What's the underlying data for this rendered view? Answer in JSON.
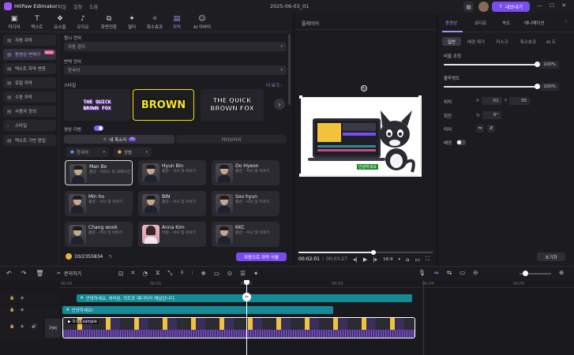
{
  "titlebar": {
    "app_title": "HitPaw Edimakor",
    "menu": [
      "파일",
      "설정",
      "도움"
    ],
    "project_name": "2025-06-03_01",
    "export_label": "내보내기",
    "window_controls": [
      "—",
      "☐",
      "✕"
    ]
  },
  "toolbar": {
    "tools": [
      {
        "label": "미디어",
        "icon": "▣"
      },
      {
        "label": "텍스트",
        "icon": "T"
      },
      {
        "label": "요소들",
        "icon": "❖"
      },
      {
        "label": "오디오",
        "icon": "♪"
      },
      {
        "label": "화면전환",
        "icon": "⧉"
      },
      {
        "label": "필터",
        "icon": "✦"
      },
      {
        "label": "특수효과",
        "icon": "✧"
      },
      {
        "label": "자막",
        "icon": "▤"
      },
      {
        "label": "AI 아바타",
        "icon": "☺"
      }
    ],
    "active_index": 7
  },
  "sidebar": {
    "items": [
      {
        "label": "자동 자막",
        "icon": "▤"
      },
      {
        "label": "동영상 번역기",
        "icon": "▤",
        "badge": "NEW"
      },
      {
        "label": "텍스트 자막 변환",
        "icon": "▤"
      },
      {
        "label": "로컬 자막",
        "icon": "▤"
      },
      {
        "label": "수동 자막",
        "icon": "▤"
      },
      {
        "label": "사용자 정의",
        "icon": "▤"
      },
      {
        "label": "스타일",
        "icon": "›"
      },
      {
        "label": "텍스트 기반 편집",
        "icon": "▤"
      }
    ],
    "active_index": 1
  },
  "translator": {
    "source_label": "원시 언어",
    "source_value": "자동 감지",
    "target_label": "번역 언어",
    "target_value": "한국어",
    "style_label": "스타일",
    "more_label": "더 보기 ›",
    "styles": [
      {
        "line1": "THE QUICK",
        "line2": "BROWN FOX"
      },
      {
        "line1": "BROWN",
        "line2": ""
      },
      {
        "line1": "THE QUICK",
        "line2": "BROWN FOX"
      }
    ],
    "dubbing_label": "영상 더빙",
    "dubbing_on": true,
    "voice_tab_mine": "내 목소리",
    "voice_tab_ai": "AI",
    "voice_tab_library": "라이브러리",
    "lang_filter": "한국어",
    "gender_filter": "성별",
    "voices": [
      {
        "name": "Man Bo",
        "desc": "중년 - 카리스 및 내레이션",
        "female": false
      },
      {
        "name": "Hyun Bin",
        "desc": "중년 - 서사 및 이야기",
        "female": false
      },
      {
        "name": "Do Hyeon",
        "desc": "중년 - 서사 및 이야기",
        "female": false
      },
      {
        "name": "Min ho",
        "desc": "중년 - 서사 및 이야기",
        "female": false
      },
      {
        "name": "BIN",
        "desc": "중년 - 서사 및 이야기",
        "female": false
      },
      {
        "name": "Soo hyun",
        "desc": "중년 - 서사 및 이야기",
        "female": false
      },
      {
        "name": "Chang wook",
        "desc": "중년 - 서사 및 이야기",
        "female": false
      },
      {
        "name": "Anna Kim",
        "desc": "어린 - 서사 및 이야기",
        "female": true
      },
      {
        "name": "KKC",
        "desc": "중년 - 서사 및 이야기",
        "female": false
      }
    ],
    "credits": "10/2355834",
    "apply_label": "자동으로 자막 식별"
  },
  "player": {
    "title": "플레이어",
    "current_time": "00:02:01",
    "total_time": "00:03:27",
    "progress": 0.56,
    "ratio": "16:9",
    "canvas_caption": "안녕하세요"
  },
  "inspector": {
    "main_tabs": [
      "동영상",
      "오디오",
      "속도",
      "애니메이션"
    ],
    "sub_tabs": [
      "일반",
      "배경 제거",
      "마스크",
      "특수효과",
      "AI 도"
    ],
    "scale_label": "비율 조정",
    "scale_value": "100%",
    "scale_level": 1.0,
    "opacity_label": "불투명도",
    "opacity_value": "100%",
    "opacity_level": 1.0,
    "position_label": "위치",
    "pos_x_label": "X",
    "pos_x": "-51",
    "pos_y_label": "Y",
    "pos_y": "55",
    "rotate_label": "회전",
    "rotate_value": "0°",
    "mirror_label": "미러",
    "bg_label": "배경",
    "reset_label": "초기화"
  },
  "timeline": {
    "split_label": "분리하기",
    "ruler": [
      "00:00",
      "00:01",
      "00:02",
      "00:03",
      "00:04",
      "00:05"
    ],
    "subtitle_clip_1": "안녕하세요, 여러분, 히트포 에디마커 채널입니다.",
    "subtitle_clip_2": "안녕하세요!",
    "video_clip": "0:03 sample",
    "cover_label": "커버"
  },
  "colors": {
    "accent": "#7a4cf0",
    "subtitle_clip": "#138a96",
    "video_clip": "#5a3a9a"
  }
}
